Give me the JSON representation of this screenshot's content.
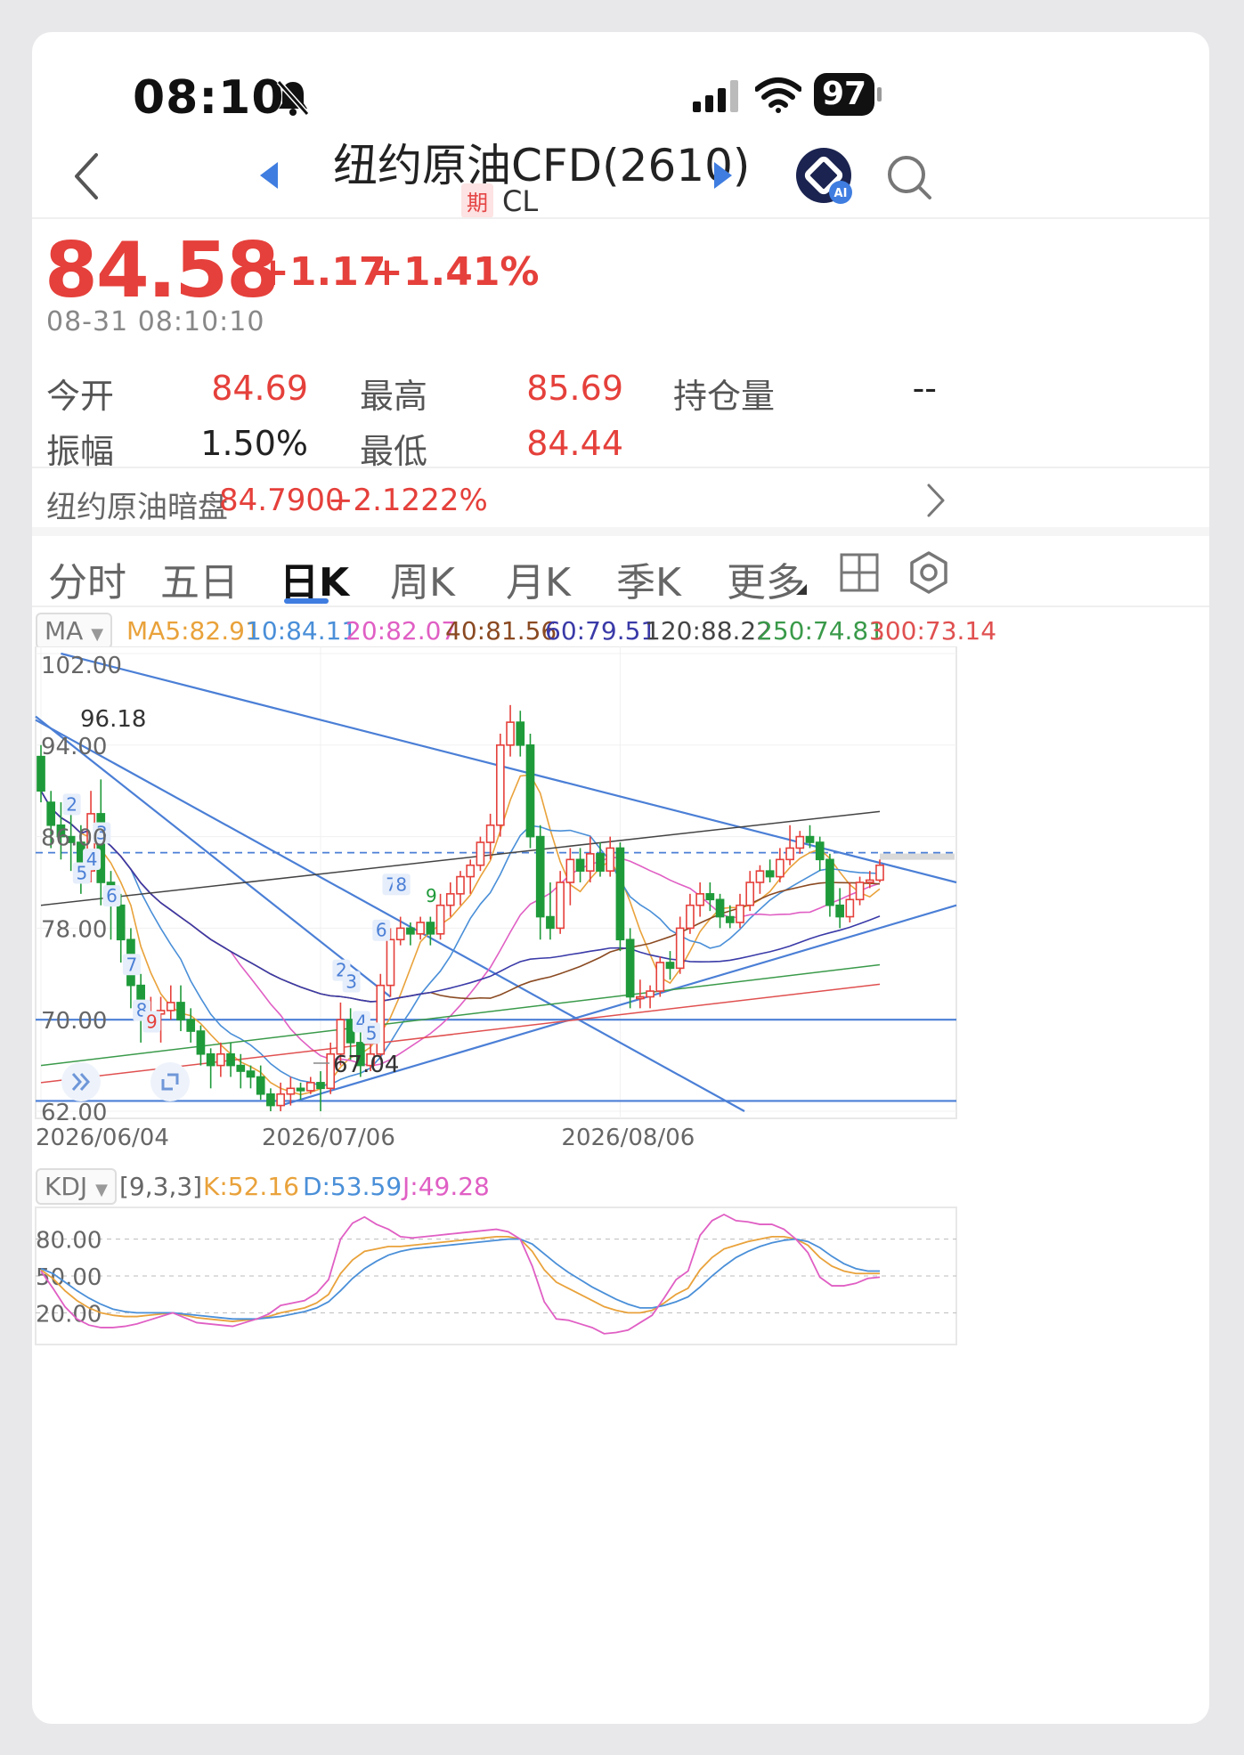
{
  "status": {
    "time": "08:10",
    "battery": "97"
  },
  "header": {
    "title": "纽约原油CFD(2610)",
    "badge": "期",
    "code": "CL"
  },
  "quote": {
    "price": "84.58",
    "change": "+1.17",
    "change_pct": "+1.41%",
    "timestamp": "08-31 08:10:10",
    "stats": [
      {
        "label": "今开",
        "value": "84.69"
      },
      {
        "label": "最高",
        "value": "85.69"
      },
      {
        "label": "持仓量",
        "value": "--"
      },
      {
        "label": "振幅",
        "value": "1.50%"
      },
      {
        "label": "最低",
        "value": "84.44"
      }
    ]
  },
  "dark_pool": {
    "label": "纽约原油暗盘",
    "value": "84.7900",
    "change": "+2.1222%"
  },
  "tabs": [
    "分时",
    "五日",
    "日K",
    "周K",
    "月K",
    "季K",
    "更多"
  ],
  "active_tab": "日K",
  "ma_legend": {
    "selector": "MA",
    "items": [
      {
        "text": "MA5:82.91",
        "color": "#e9a23b"
      },
      {
        "text": "10:84.11",
        "color": "#4a8fd8"
      },
      {
        "text": "20:82.07",
        "color": "#e05fc4"
      },
      {
        "text": "40:81.56",
        "color": "#8a4a22"
      },
      {
        "text": "60:79.51",
        "color": "#3a3aa8"
      },
      {
        "text": "120:88.22",
        "color": "#444444"
      },
      {
        "text": "250:74.81",
        "color": "#3a9a4a"
      },
      {
        "text": "300:73.14",
        "color": "#e05050"
      }
    ]
  },
  "kdj_legend": {
    "selector": "KDJ",
    "params": "[9,3,3]",
    "items": [
      {
        "text": "K:52.16",
        "color": "#e9a23b"
      },
      {
        "text": "D:53.59",
        "color": "#4a8fd8"
      },
      {
        "text": "J:49.28",
        "color": "#e05fc4"
      }
    ]
  },
  "chart_data": [
    {
      "type": "candlestick",
      "y_ticks": [
        "102.00",
        "94.00",
        "86.00",
        "78.00",
        "70.00",
        "62.00"
      ],
      "ylim": [
        62,
        102
      ],
      "x_ticks": [
        "2026/06/04",
        "2026/07/06",
        "2026/08/06"
      ],
      "annotations": [
        "96.18",
        "67.04"
      ],
      "wave_labels": [
        "2",
        "3",
        "4",
        "5",
        "6",
        "7",
        "8",
        "9",
        "2",
        "3",
        "4",
        "5",
        "6",
        "7",
        "8",
        "9"
      ],
      "current_price": 84.58,
      "candles": [
        [
          93,
          90,
          94,
          89
        ],
        [
          89,
          87,
          90,
          85
        ],
        [
          87,
          86,
          89,
          84
        ],
        [
          86,
          85.5,
          88,
          83
        ],
        [
          85.5,
          83,
          87,
          81
        ],
        [
          83,
          88,
          90,
          82
        ],
        [
          88,
          82,
          91,
          80
        ],
        [
          82,
          80,
          83,
          77
        ],
        [
          80,
          77,
          81,
          75
        ],
        [
          77,
          73,
          78,
          71
        ],
        [
          73,
          70,
          74,
          68
        ],
        [
          70,
          70.5,
          72,
          69
        ],
        [
          70.5,
          70.8,
          72,
          68
        ],
        [
          70.8,
          71.5,
          73,
          70
        ],
        [
          71.5,
          70,
          73,
          69
        ],
        [
          70,
          69,
          71,
          68
        ],
        [
          69,
          67,
          69.5,
          66
        ],
        [
          67,
          66,
          67.5,
          64
        ],
        [
          66,
          67,
          68,
          65
        ],
        [
          67,
          66,
          68,
          65
        ],
        [
          66,
          65.5,
          67,
          64
        ],
        [
          65.5,
          65,
          66,
          64
        ],
        [
          65,
          63.5,
          66,
          63
        ],
        [
          63.5,
          62.5,
          64,
          62
        ],
        [
          62.5,
          63.5,
          64.5,
          62
        ],
        [
          63.5,
          64,
          65,
          62.5
        ],
        [
          64,
          63.8,
          64.5,
          63
        ],
        [
          63.8,
          64.5,
          65,
          63.5
        ],
        [
          64.5,
          64,
          65.5,
          62
        ],
        [
          64,
          67,
          68,
          63.5
        ],
        [
          67,
          70,
          71.5,
          66
        ],
        [
          70,
          68,
          71,
          66.5
        ],
        [
          68,
          66,
          69,
          65
        ],
        [
          66,
          67,
          68,
          65.5
        ],
        [
          67,
          73,
          74,
          66.5
        ],
        [
          73,
          77,
          78,
          72
        ],
        [
          77,
          78,
          79,
          76.5
        ],
        [
          78,
          77.5,
          78.5,
          76.5
        ],
        [
          77.5,
          78.5,
          79,
          77
        ],
        [
          78.5,
          77.5,
          79,
          76.5
        ],
        [
          77.5,
          80,
          81,
          77
        ],
        [
          80,
          81,
          82,
          79
        ],
        [
          81,
          82.5,
          83,
          80
        ],
        [
          82.5,
          83.5,
          84,
          81
        ],
        [
          83.5,
          85.5,
          86,
          83
        ],
        [
          85.5,
          87,
          88,
          84
        ],
        [
          87,
          94,
          95,
          86
        ],
        [
          94,
          96,
          97.5,
          93
        ],
        [
          96,
          94,
          97,
          93
        ],
        [
          94,
          86,
          95,
          85
        ],
        [
          86,
          79,
          87,
          77
        ],
        [
          79,
          78,
          82,
          77
        ],
        [
          78,
          82,
          83,
          77.5
        ],
        [
          82,
          84,
          85,
          80
        ],
        [
          84,
          83,
          85,
          82
        ],
        [
          83,
          84.5,
          86,
          82
        ],
        [
          84.5,
          83,
          85.5,
          82.5
        ],
        [
          83,
          85,
          86,
          82.5
        ],
        [
          85,
          77,
          85.5,
          76
        ],
        [
          77,
          72,
          78,
          71
        ],
        [
          72,
          72,
          73.5,
          71
        ],
        [
          72,
          72.5,
          73,
          71
        ],
        [
          72.5,
          75,
          75.5,
          72
        ],
        [
          75,
          74.5,
          76,
          73.5
        ],
        [
          74.5,
          78,
          79,
          74
        ],
        [
          78,
          80,
          81,
          77.5
        ],
        [
          80,
          81,
          82,
          79
        ],
        [
          81,
          80.5,
          82,
          79.5
        ],
        [
          80.5,
          79,
          81,
          78
        ],
        [
          79,
          78.5,
          80,
          78
        ],
        [
          78.5,
          80,
          81,
          78
        ],
        [
          80,
          82,
          83,
          79.5
        ],
        [
          82,
          83,
          83.5,
          81
        ],
        [
          83,
          82.5,
          84,
          82
        ],
        [
          82.5,
          84,
          85,
          82
        ],
        [
          84,
          85,
          87,
          83.5
        ],
        [
          85,
          86,
          86.5,
          84.5
        ],
        [
          86,
          85.5,
          87,
          85
        ],
        [
          85.5,
          84,
          86,
          83
        ],
        [
          84,
          80,
          84.5,
          79
        ],
        [
          80,
          79,
          81.5,
          78
        ],
        [
          79,
          80.5,
          82,
          78.5
        ],
        [
          80.5,
          82,
          82.5,
          80
        ],
        [
          82,
          82.2,
          83,
          81.5
        ],
        [
          82.2,
          83.5,
          84,
          82
        ]
      ]
    },
    {
      "type": "line",
      "name": "KDJ",
      "y_ticks": [
        "80.00",
        "50.00",
        "20.00"
      ],
      "ylim": [
        0,
        100
      ],
      "series": [
        {
          "name": "K",
          "values": [
            55,
            48,
            38,
            30,
            24,
            20,
            18,
            17,
            17,
            18,
            19,
            20,
            18,
            16,
            15,
            14,
            13,
            14,
            15,
            17,
            20,
            22,
            24,
            28,
            35,
            52,
            63,
            70,
            72,
            74,
            74,
            75,
            76,
            77,
            78,
            79,
            80,
            81,
            82,
            82,
            80,
            70,
            55,
            45,
            40,
            35,
            30,
            25,
            22,
            20,
            20,
            22,
            28,
            35,
            40,
            55,
            65,
            72,
            75,
            78,
            80,
            82,
            82,
            80,
            75,
            65,
            58,
            54,
            52,
            52,
            52
          ]
        },
        {
          "name": "D",
          "values": [
            56,
            52,
            45,
            38,
            32,
            27,
            23,
            21,
            20,
            20,
            20,
            20,
            19,
            18,
            17,
            16,
            15,
            15,
            15,
            16,
            17,
            19,
            21,
            24,
            29,
            38,
            48,
            56,
            62,
            67,
            70,
            72,
            73,
            74,
            75,
            76,
            77,
            78,
            79,
            80,
            80,
            76,
            68,
            60,
            53,
            47,
            41,
            36,
            31,
            27,
            24,
            24,
            26,
            29,
            33,
            41,
            50,
            58,
            65,
            70,
            74,
            77,
            79,
            80,
            78,
            73,
            66,
            60,
            56,
            54,
            54
          ]
        },
        {
          "name": "J",
          "values": [
            54,
            40,
            25,
            15,
            10,
            8,
            8,
            9,
            11,
            14,
            17,
            20,
            16,
            12,
            11,
            10,
            9,
            12,
            15,
            19,
            26,
            28,
            30,
            36,
            47,
            80,
            93,
            98,
            92,
            88,
            82,
            81,
            82,
            83,
            84,
            85,
            86,
            87,
            88,
            86,
            80,
            58,
            29,
            15,
            14,
            11,
            8,
            3,
            4,
            6,
            12,
            18,
            32,
            47,
            54,
            83,
            95,
            100,
            95,
            94,
            92,
            92,
            88,
            80,
            69,
            49,
            42,
            42,
            44,
            48,
            49
          ]
        }
      ]
    }
  ]
}
